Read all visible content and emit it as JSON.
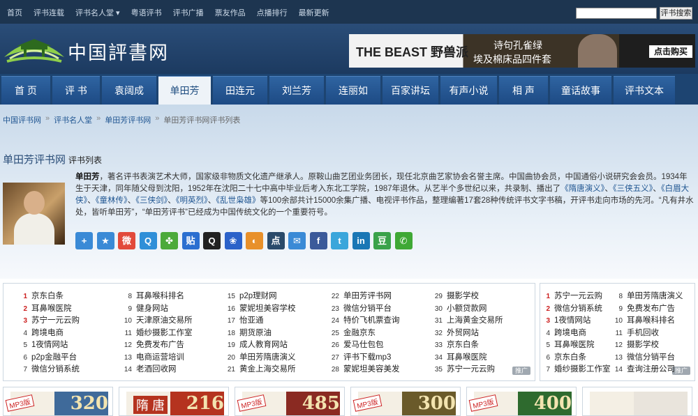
{
  "topbar": {
    "links": [
      "首页",
      "评书连载",
      "评书名人堂 ▾",
      "粤语评书",
      "评书广播",
      "票友作品",
      "点播排行",
      "最新更新"
    ],
    "search_placeholder": "",
    "search_button": "评书搜索"
  },
  "header": {
    "logo_text": "中国評書网",
    "ad": {
      "brand": "THE BEAST 野兽派",
      "line1": "诗句孔雀绿",
      "line2": "埃及棉床品四件套",
      "cta": "点击购买"
    }
  },
  "mainnav": {
    "items": [
      "首 页",
      "评 书",
      "袁阔成",
      "单田芳",
      "田连元",
      "刘兰芳",
      "连丽如",
      "百家讲坛",
      "有声小说",
      "相 声",
      "童话故事",
      "评书文本"
    ],
    "active_index": 3
  },
  "breadcrumb": {
    "items": [
      "中国评书网",
      "评书名人堂",
      "单田芳评书网"
    ],
    "current": "单田芳评书网评书列表",
    "separator": "»"
  },
  "page": {
    "title": "单田芳评书网",
    "subtitle": "评书列表"
  },
  "bio": {
    "name": "单田芳",
    "text1": "，著名评书表演艺术大师，国家级非物质文化遗产继承人。原鞍山曲艺团业务团长，现任北京曲艺家协会名誉主席。中国曲协会员，中国通俗小说研究会会员。1934年生于天津，同年随父母到沈阳，1952年在沈阳二十七中高中毕业后考入东北工学院，1987年退休。从艺半个多世纪以来，共录制、播出了",
    "works": [
      "《隋唐演义》",
      "《三侠五义》",
      "《白眉大侠》",
      "《童林传》",
      "《三侠剑》",
      "《明英烈》",
      "《乱世枭雄》"
    ],
    "text2": "等100余部共计15000余集广播、电视评书作品，整理编著17套28种传统评书文字书稿，开评书走向市场的先河。“凡有井水处，皆听单田芳”，“单田芳评书”已经成为中国传统文化的一个重要符号。"
  },
  "share": [
    {
      "name": "share-more-icon",
      "glyph": "+",
      "color": "#3a8ad6"
    },
    {
      "name": "favorite-star-icon",
      "glyph": "★",
      "color": "#3a8ad6"
    },
    {
      "name": "weibo-icon",
      "glyph": "微",
      "color": "#e24a3b"
    },
    {
      "name": "qzone-icon",
      "glyph": "Q",
      "color": "#2f8fd8"
    },
    {
      "name": "clover-icon",
      "glyph": "✤",
      "color": "#4caa3a"
    },
    {
      "name": "tieba-icon",
      "glyph": "贴",
      "color": "#2b6fd0"
    },
    {
      "name": "qq-icon",
      "glyph": "Q",
      "color": "#222222"
    },
    {
      "name": "baidu-icon",
      "glyph": "❀",
      "color": "#2b62c9"
    },
    {
      "name": "sohu-icon",
      "glyph": "◐",
      "color": "#e8902a"
    },
    {
      "name": "dianping-icon",
      "glyph": "点",
      "color": "#2a4a6a"
    },
    {
      "name": "email-icon",
      "glyph": "✉",
      "color": "#3a8ad6"
    },
    {
      "name": "facebook-icon",
      "glyph": "f",
      "color": "#3b5a9a"
    },
    {
      "name": "twitter-icon",
      "glyph": "t",
      "color": "#3aa6db"
    },
    {
      "name": "linkedin-icon",
      "glyph": "in",
      "color": "#1a77b5"
    },
    {
      "name": "douban-icon",
      "glyph": "豆",
      "color": "#3aa24a"
    },
    {
      "name": "wechat-icon",
      "glyph": "✆",
      "color": "#3fa835"
    }
  ],
  "link_columns": [
    [
      {
        "n": "1",
        "t": "京东白条"
      },
      {
        "n": "2",
        "t": "耳鼻喉医院"
      },
      {
        "n": "3",
        "t": "苏宁一元云购"
      },
      {
        "n": "4",
        "t": "跨境电商"
      },
      {
        "n": "5",
        "t": "1夜情网站"
      },
      {
        "n": "6",
        "t": "p2p金融平台"
      },
      {
        "n": "7",
        "t": "微信分销系统"
      }
    ],
    [
      {
        "n": "8",
        "t": "耳鼻喉科排名"
      },
      {
        "n": "9",
        "t": "健身网站"
      },
      {
        "n": "10",
        "t": "天津原油交易所"
      },
      {
        "n": "11",
        "t": "婚纱摄影工作室"
      },
      {
        "n": "12",
        "t": "免费发布广告"
      },
      {
        "n": "13",
        "t": "电商运营培训"
      },
      {
        "n": "14",
        "t": "老酒回收网"
      }
    ],
    [
      {
        "n": "15",
        "t": "p2p理财网"
      },
      {
        "n": "16",
        "t": "蒙妮坦美容学校"
      },
      {
        "n": "17",
        "t": "怡亚通"
      },
      {
        "n": "18",
        "t": "期货原油"
      },
      {
        "n": "19",
        "t": "成人教育网站"
      },
      {
        "n": "20",
        "t": "单田芳隋唐演义"
      },
      {
        "n": "21",
        "t": "黄金上海交易所"
      }
    ],
    [
      {
        "n": "22",
        "t": "单田芳评书网"
      },
      {
        "n": "23",
        "t": "微信分销平台"
      },
      {
        "n": "24",
        "t": "特价飞机票查询"
      },
      {
        "n": "25",
        "t": "金融京东"
      },
      {
        "n": "26",
        "t": "爱马仕包包"
      },
      {
        "n": "27",
        "t": "评书下载mp3"
      },
      {
        "n": "28",
        "t": "蒙妮坦美容美发"
      }
    ],
    [
      {
        "n": "29",
        "t": "摄影学校"
      },
      {
        "n": "30",
        "t": "小额贷款网"
      },
      {
        "n": "31",
        "t": "上海黄金交易所"
      },
      {
        "n": "32",
        "t": "外贸网站"
      },
      {
        "n": "33",
        "t": "京东白条"
      },
      {
        "n": "34",
        "t": "耳鼻喉医院"
      },
      {
        "n": "35",
        "t": "苏宁一元云购"
      }
    ]
  ],
  "side_columns": [
    [
      {
        "n": "1",
        "t": "苏宁一元云购"
      },
      {
        "n": "2",
        "t": "微信分销系统"
      },
      {
        "n": "3",
        "t": "1夜情网站"
      },
      {
        "n": "4",
        "t": "跨境电商"
      },
      {
        "n": "5",
        "t": "耳鼻喉医院"
      },
      {
        "n": "6",
        "t": "京东白条"
      },
      {
        "n": "7",
        "t": "婚纱摄影工作室"
      }
    ],
    [
      {
        "n": "8",
        "t": "单田芳隋唐演义"
      },
      {
        "n": "9",
        "t": "免费发布广告"
      },
      {
        "n": "10",
        "t": "耳鼻喉科排名"
      },
      {
        "n": "11",
        "t": "手机回收"
      },
      {
        "n": "12",
        "t": "摄影学校"
      },
      {
        "n": "13",
        "t": "微信分销平台"
      },
      {
        "n": "14",
        "t": "查询注册公司"
      }
    ]
  ],
  "ad_tag": "推广",
  "thumbs": [
    {
      "badge": "MP3版",
      "num": "320",
      "bg": "#3f6a9a"
    },
    {
      "badge": "",
      "num": "216",
      "bg": "#b5331f",
      "title": "隋 唐"
    },
    {
      "badge": "MP3版",
      "num": "485",
      "bg": "#8a2a22"
    },
    {
      "badge": "MP3版",
      "num": "300",
      "bg": "#6a5a2a"
    },
    {
      "badge": "MP3版",
      "num": "400",
      "bg": "#2e6a2e"
    },
    {
      "badge": "",
      "num": "",
      "bg": "#e9e4dc"
    }
  ]
}
